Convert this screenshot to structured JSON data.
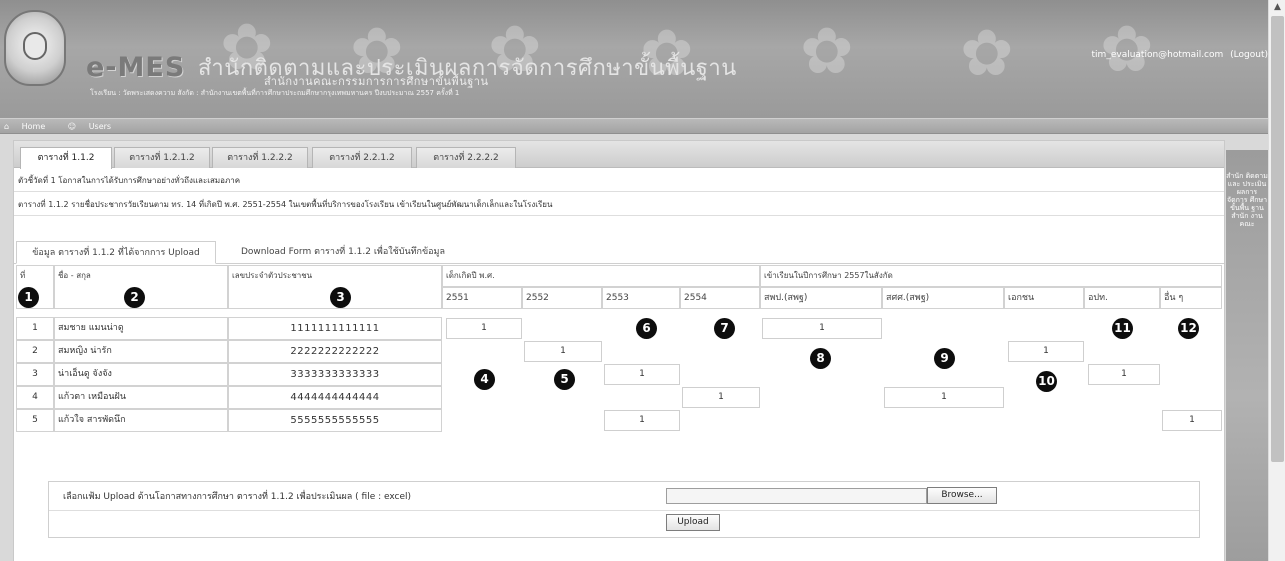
{
  "header": {
    "brand": "e-MES",
    "title": "สำนักติดตามและประเมินผลการจัดการศึกษาขั้นพื้นฐาน",
    "subtitle": "สำนักงานคณะกรรมการการศึกษาขั้นพื้นฐาน",
    "school_info": "โรงเรียน : วัดพระเสดงความ    สังกัด : สำนักงานเขตพื้นที่การศึกษาประถมศึกษากรุงเทพมหานคร    ปีงบประมาณ 2557 ครั้งที่ 1",
    "user_email": "tim_evaluation@hotmail.com",
    "logout_label": "(Logout)"
  },
  "nav": {
    "home_label": "Home",
    "users_label": "Users"
  },
  "tabs": [
    {
      "label": "ตารางที่ 1.1.2"
    },
    {
      "label": "ตารางที่ 1.2.1.2"
    },
    {
      "label": "ตารางที่ 1.2.2.2"
    },
    {
      "label": "ตารางที่ 2.2.1.2"
    },
    {
      "label": "ตารางที่ 2.2.2.2"
    }
  ],
  "indicator": "ตัวชี้วัดที่ 1 โอกาสในการได้รับการศึกษาอย่างทั่วถึงและเสมอภาค",
  "table_caption": "ตารางที่ 1.1.2 รายชื่อประชากรวัยเรียนตาม ทร. 14 ที่เกิดปี พ.ศ. 2551-2554 ในเขตพื้นที่บริการของโรงเรียน เข้าเรียนในศูนย์พัฒนาเด็กเล็กและในโรงเรียน",
  "subtabs": {
    "data_label": "ข้อมูล ตารางที่ 1.1.2 ที่ได้จากการ Upload",
    "download_label": "Download Form ตารางที่ 1.1.2 เพื่อใช้บันทึกข้อมูล"
  },
  "columns": {
    "no": "ที่",
    "name": "ชื่อ - สกุล",
    "id": "เลขประจำตัวประชาชน",
    "born_group": "เด็กเกิดปี พ.ศ.",
    "enrolled_group": "เข้าเรียนในปีการศึกษา 2557ในสังกัด",
    "years": [
      "2551",
      "2552",
      "2553",
      "2554"
    ],
    "agencies": [
      "สพป.(สพฐ)",
      "สศศ.(สพฐ)",
      "เอกชน",
      "อปท.",
      "อื่น ๆ"
    ]
  },
  "rows": [
    {
      "no": "1",
      "name": "สมชาย แมนน่าดู",
      "id": "1111111111111",
      "y2551": "1",
      "y2552": "",
      "y2553": "",
      "y2554": "",
      "a1": "1",
      "a2": "",
      "a3": "",
      "a4": "",
      "a5": ""
    },
    {
      "no": "2",
      "name": "สมหญิง น่ารัก",
      "id": "2222222222222",
      "y2551": "",
      "y2552": "1",
      "y2553": "",
      "y2554": "",
      "a1": "",
      "a2": "",
      "a3": "1",
      "a4": "",
      "a5": ""
    },
    {
      "no": "3",
      "name": "น่าเอ็นดู จังจัง",
      "id": "3333333333333",
      "y2551": "",
      "y2552": "",
      "y2553": "1",
      "y2554": "",
      "a1": "",
      "a2": "",
      "a3": "",
      "a4": "1",
      "a5": ""
    },
    {
      "no": "4",
      "name": "แก้วตา เหมือนฝัน",
      "id": "4444444444444",
      "y2551": "",
      "y2552": "",
      "y2553": "",
      "y2554": "1",
      "a1": "",
      "a2": "1",
      "a3": "",
      "a4": "",
      "a5": ""
    },
    {
      "no": "5",
      "name": "แก้วใจ สารพัดนึก",
      "id": "5555555555555",
      "y2551": "",
      "y2552": "",
      "y2553": "1",
      "y2554": "",
      "a1": "",
      "a2": "",
      "a3": "",
      "a4": "",
      "a5": "1"
    }
  ],
  "markers": [
    "1",
    "2",
    "3",
    "4",
    "5",
    "6",
    "7",
    "8",
    "9",
    "10",
    "11",
    "12"
  ],
  "upload": {
    "label": "เลือกแฟ้ม Upload ด้านโอกาสทางการศึกษา ตารางที่ 1.1.2 เพื่อประเมินผล ( file : excel)",
    "browse_label": "Browse...",
    "upload_label": "Upload"
  },
  "sidebar_text": "สำนัก ติดตาม และ ประเมิน ผลการ จัดการ ศึกษา ขั้นพื้น ฐาน สำนัก งานคณะ"
}
